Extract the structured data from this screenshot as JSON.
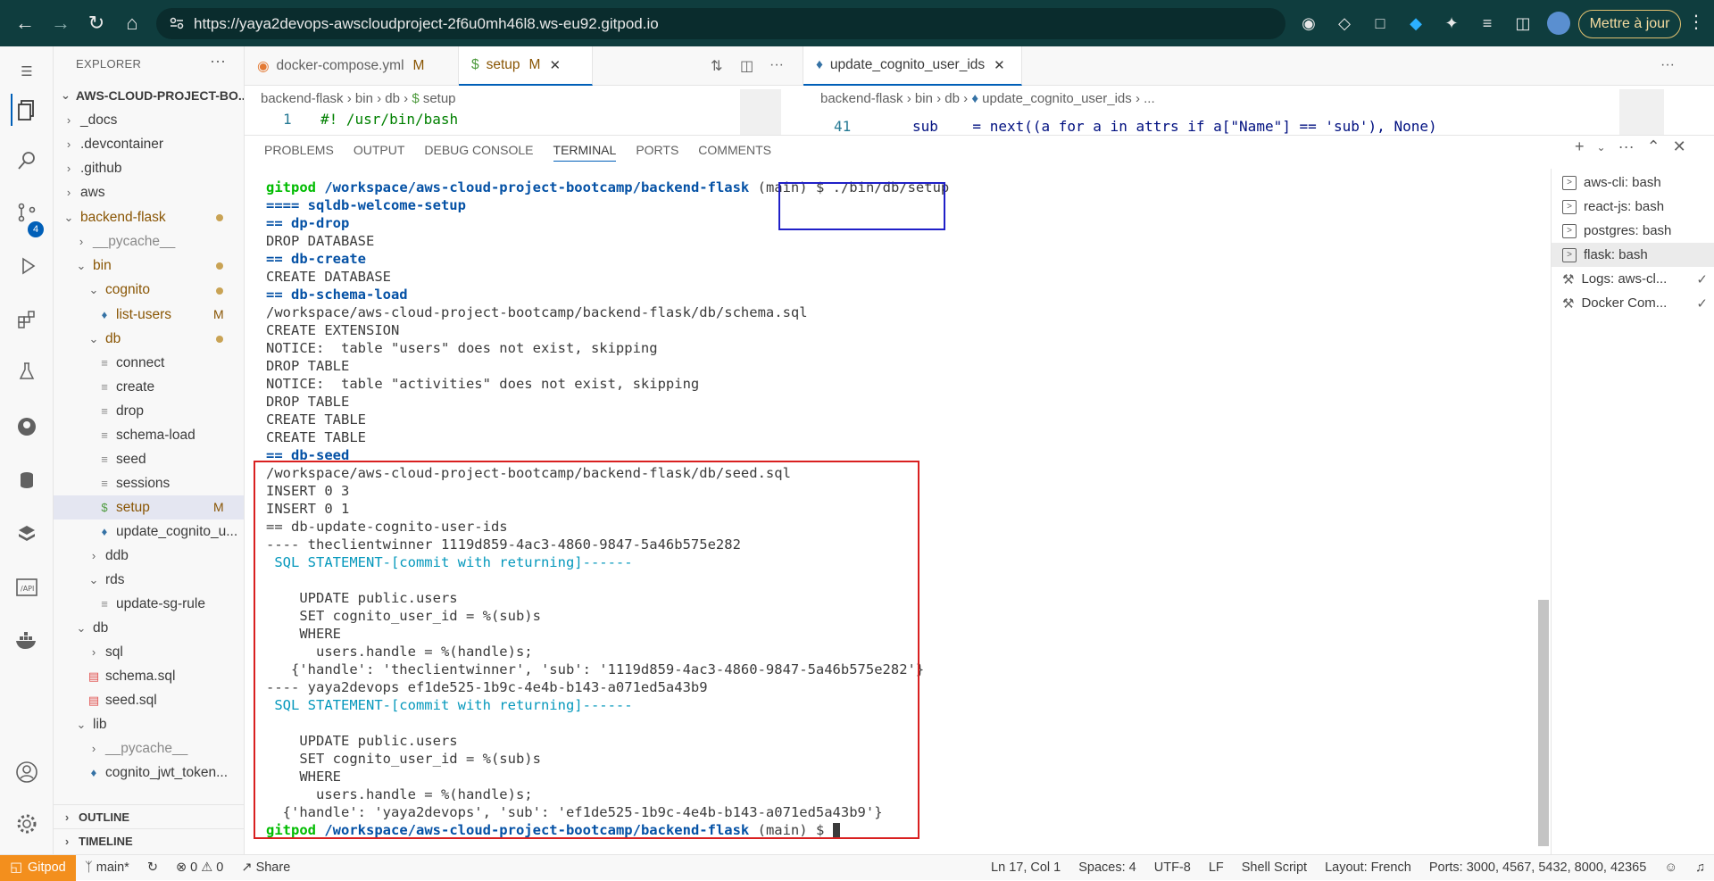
{
  "browser": {
    "url": "https://yaya2devops-awscloudproject-2f6u0mh46l8.ws-eu92.gitpod.io",
    "update_label": "Mettre à jour"
  },
  "activity_bar": {
    "scm_badge": "4"
  },
  "explorer": {
    "title": "EXPLORER",
    "root": "AWS-CLOUD-PROJECT-BO...",
    "items": [
      {
        "label": "_docs"
      },
      {
        "label": ".devcontainer"
      },
      {
        "label": ".github"
      },
      {
        "label": "aws"
      },
      {
        "label": "backend-flask"
      },
      {
        "label": "__pycache__"
      },
      {
        "label": "bin"
      },
      {
        "label": "cognito"
      },
      {
        "label": "list-users",
        "status": "M"
      },
      {
        "label": "db"
      },
      {
        "label": "connect"
      },
      {
        "label": "create"
      },
      {
        "label": "drop"
      },
      {
        "label": "schema-load"
      },
      {
        "label": "seed"
      },
      {
        "label": "sessions"
      },
      {
        "label": "setup",
        "status": "M"
      },
      {
        "label": "update_cognito_u..."
      },
      {
        "label": "ddb"
      },
      {
        "label": "rds"
      },
      {
        "label": "update-sg-rule"
      },
      {
        "label": "db"
      },
      {
        "label": "sql"
      },
      {
        "label": "schema.sql"
      },
      {
        "label": "seed.sql"
      },
      {
        "label": "lib"
      },
      {
        "label": "__pycache__"
      },
      {
        "label": "cognito_jwt_token..."
      }
    ],
    "outline": "OUTLINE",
    "timeline": "TIMELINE"
  },
  "editor_left": {
    "tabs": [
      {
        "label": "docker-compose.yml",
        "status": "M"
      },
      {
        "label": "setup",
        "status": "M"
      }
    ],
    "breadcrumb": [
      "backend-flask",
      "bin",
      "db",
      "setup"
    ],
    "line_number": "1",
    "line_text": "#! /usr/bin/bash"
  },
  "editor_right": {
    "tab": "update_cognito_user_ids",
    "breadcrumb": [
      "backend-flask",
      "bin",
      "db",
      "update_cognito_user_ids",
      "..."
    ],
    "line_number": "41",
    "line_text": "sub    = next((a for a in attrs if a[\"Name\"] == 'sub'), None)"
  },
  "panel": {
    "tabs": [
      "PROBLEMS",
      "OUTPUT",
      "DEBUG CONSOLE",
      "TERMINAL",
      "PORTS",
      "COMMENTS"
    ],
    "prompt_user": "gitpod",
    "prompt_path": "/workspace/aws-cloud-project-bootcamp/backend-flask",
    "prompt_branch": "(main)",
    "command": "$ ./bin/db/setup",
    "lines": [
      {
        "t": "==== sqldb-welcome-setup",
        "c": "blue"
      },
      {
        "t": "== dp-drop",
        "c": "blue"
      },
      {
        "t": "DROP DATABASE",
        "c": ""
      },
      {
        "t": "== db-create",
        "c": "blue"
      },
      {
        "t": "CREATE DATABASE",
        "c": ""
      },
      {
        "t": "== db-schema-load",
        "c": "blue"
      },
      {
        "t": "/workspace/aws-cloud-project-bootcamp/backend-flask/db/schema.sql",
        "c": ""
      },
      {
        "t": "CREATE EXTENSION",
        "c": ""
      },
      {
        "t": "NOTICE:  table \"users\" does not exist, skipping",
        "c": ""
      },
      {
        "t": "DROP TABLE",
        "c": ""
      },
      {
        "t": "NOTICE:  table \"activities\" does not exist, skipping",
        "c": ""
      },
      {
        "t": "DROP TABLE",
        "c": ""
      },
      {
        "t": "CREATE TABLE",
        "c": ""
      },
      {
        "t": "CREATE TABLE",
        "c": ""
      },
      {
        "t": "== db-seed",
        "c": "blue"
      },
      {
        "t": "/workspace/aws-cloud-project-bootcamp/backend-flask/db/seed.sql",
        "c": ""
      },
      {
        "t": "INSERT 0 3",
        "c": ""
      },
      {
        "t": "INSERT 0 1",
        "c": ""
      },
      {
        "t": "== db-update-cognito-user-ids",
        "c": ""
      },
      {
        "t": "---- theclientwinner 1119d859-4ac3-4860-9847-5a46b575e282",
        "c": ""
      },
      {
        "t": " SQL STATEMENT-[commit with returning]------",
        "c": "teal"
      },
      {
        "t": "",
        "c": ""
      },
      {
        "t": "    UPDATE public.users",
        "c": ""
      },
      {
        "t": "    SET cognito_user_id = %(sub)s",
        "c": ""
      },
      {
        "t": "    WHERE",
        "c": ""
      },
      {
        "t": "      users.handle = %(handle)s;",
        "c": ""
      },
      {
        "t": "   {'handle': 'theclientwinner', 'sub': '1119d859-4ac3-4860-9847-5a46b575e282'}",
        "c": ""
      },
      {
        "t": "---- yaya2devops ef1de525-1b9c-4e4b-b143-a071ed5a43b9",
        "c": ""
      },
      {
        "t": " SQL STATEMENT-[commit with returning]------",
        "c": "teal"
      },
      {
        "t": "",
        "c": ""
      },
      {
        "t": "    UPDATE public.users",
        "c": ""
      },
      {
        "t": "    SET cognito_user_id = %(sub)s",
        "c": ""
      },
      {
        "t": "    WHERE",
        "c": ""
      },
      {
        "t": "      users.handle = %(handle)s;",
        "c": ""
      },
      {
        "t": "  {'handle': 'yaya2devops', 'sub': 'ef1de525-1b9c-4e4b-b143-a071ed5a43b9'}",
        "c": ""
      }
    ],
    "final_prompt_tail": "$",
    "terminals": [
      {
        "label": "aws-cli: bash"
      },
      {
        "label": "react-js: bash"
      },
      {
        "label": "postgres: bash"
      },
      {
        "label": "flask: bash"
      },
      {
        "label": "Logs: aws-cl..."
      },
      {
        "label": "Docker Com..."
      }
    ]
  },
  "status_bar": {
    "remote": "Gitpod",
    "branch": "main*",
    "errors": "0",
    "warnings": "0",
    "share": "Share",
    "cursor": "Ln 17, Col 1",
    "spaces": "Spaces: 4",
    "encoding": "UTF-8",
    "eol": "LF",
    "language": "Shell Script",
    "layout": "Layout: French",
    "ports": "Ports: 3000, 4567, 5432, 8000, 42365"
  }
}
